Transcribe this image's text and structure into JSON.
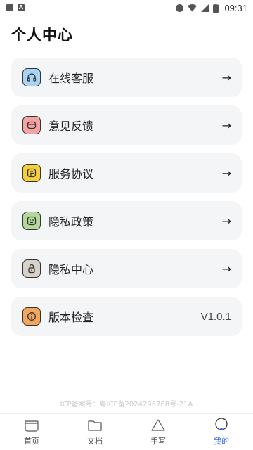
{
  "status_bar": {
    "time": "09:31"
  },
  "page": {
    "title": "个人中心"
  },
  "menu": {
    "items": [
      {
        "label": "在线客服",
        "icon": "headset-icon",
        "icon_bg": "#a9d3f5",
        "trailing": "→"
      },
      {
        "label": "意见反馈",
        "icon": "feedback-icon",
        "icon_bg": "#f5a3a3",
        "trailing": "→"
      },
      {
        "label": "服务协议",
        "icon": "agreement-icon",
        "icon_bg": "#f7cf3b",
        "trailing": "→"
      },
      {
        "label": "隐私政策",
        "icon": "privacy-policy-icon",
        "icon_bg": "#b4d89a",
        "trailing": "→"
      },
      {
        "label": "隐私中心",
        "icon": "lock-icon",
        "icon_bg": "#d7d2c9",
        "trailing": "→"
      },
      {
        "label": "版本检查",
        "icon": "info-icon",
        "icon_bg": "#f3a75c",
        "trailing": "V1.0.1"
      }
    ]
  },
  "footer": {
    "icp": "ICP备案号：粤ICP备2024296788号-21A"
  },
  "tab_bar": {
    "tabs": [
      {
        "label": "首页",
        "icon": "home-icon"
      },
      {
        "label": "文档",
        "icon": "folder-icon"
      },
      {
        "label": "手写",
        "icon": "triangle-icon"
      },
      {
        "label": "我的",
        "icon": "profile-icon",
        "active": true
      }
    ],
    "accent": "#2b6cf0"
  }
}
